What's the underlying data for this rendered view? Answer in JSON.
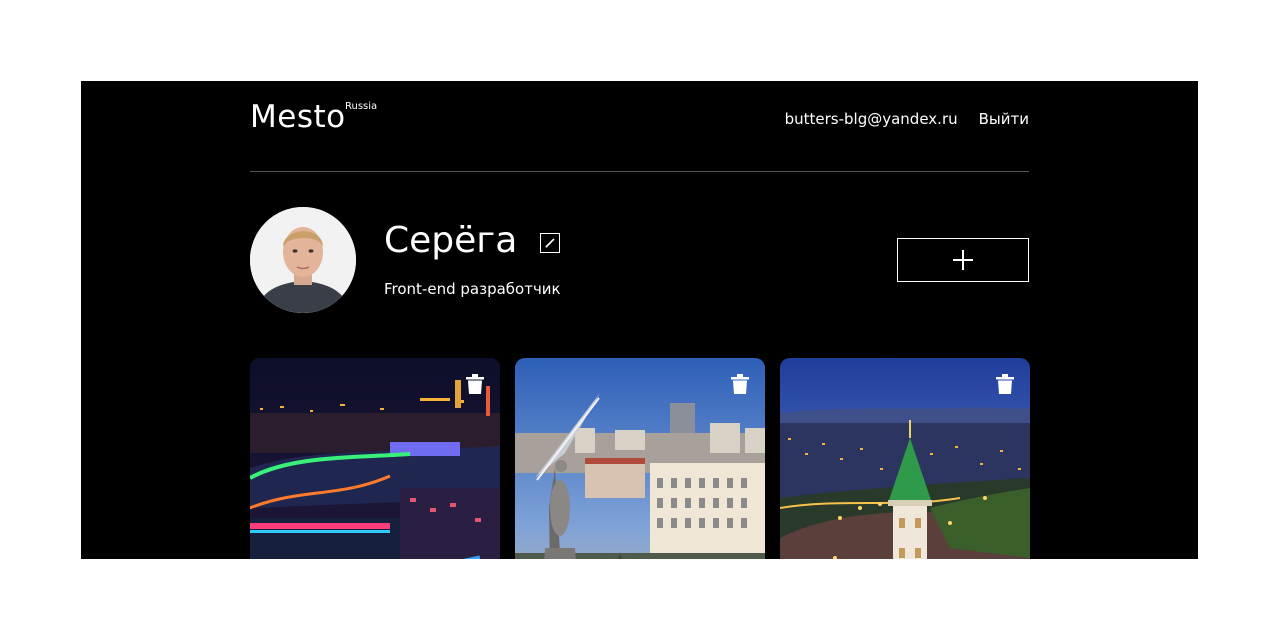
{
  "header": {
    "logo": "Mesto",
    "logo_sup": "Russia",
    "email": "butters-blg@yandex.ru",
    "logout_label": "Выйти"
  },
  "profile": {
    "name": "Серёга",
    "about": "Front-end разработчик"
  },
  "icons": {
    "edit": "pencil-icon",
    "add": "plus-icon",
    "delete": "trash-icon"
  },
  "cards": [
    {
      "name": "card-1-night-city-river-bridges"
    },
    {
      "name": "card-2-monument-city-buildings"
    },
    {
      "name": "card-3-green-spire-tower-night"
    }
  ]
}
